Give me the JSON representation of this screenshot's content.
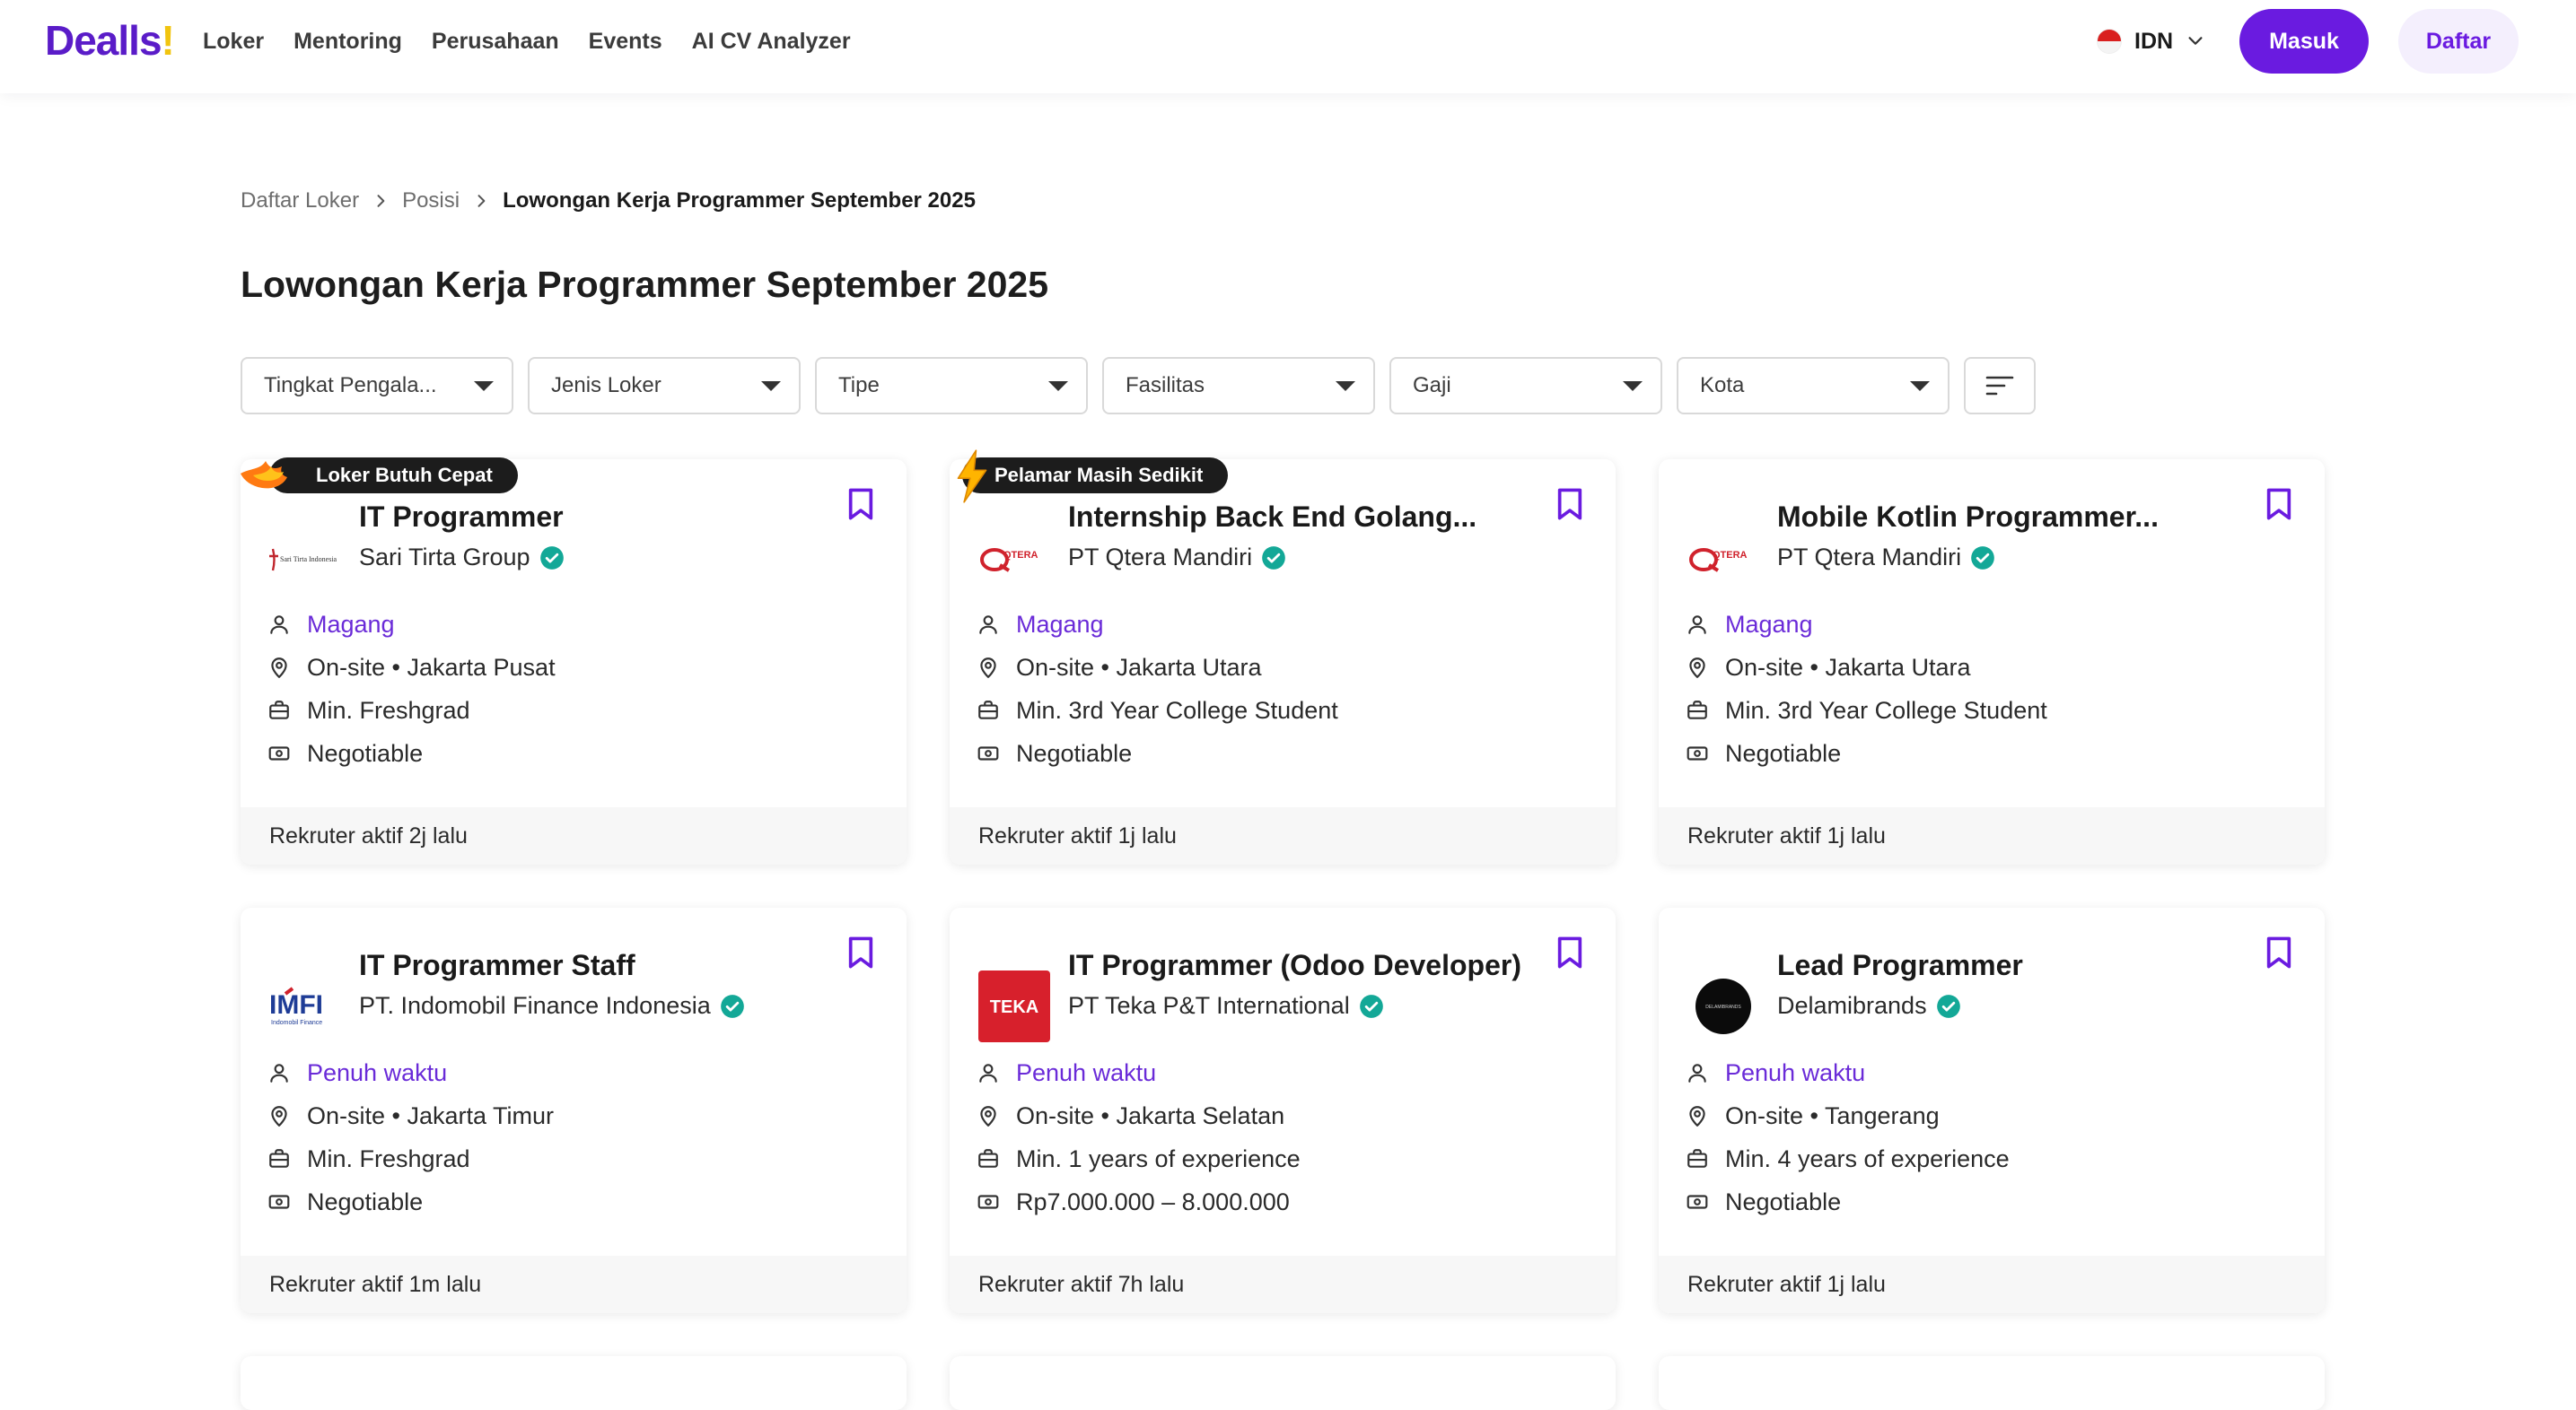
{
  "header": {
    "logo_text": "Dealls",
    "logo_accent": "!",
    "nav": [
      "Loker",
      "Mentoring",
      "Perusahaan",
      "Events",
      "AI CV Analyzer"
    ],
    "lang": "IDN",
    "login": "Masuk",
    "register": "Daftar"
  },
  "breadcrumb": [
    "Daftar Loker",
    "Posisi",
    "Lowongan Kerja Programmer September 2025"
  ],
  "page_title": "Lowongan Kerja Programmer September 2025",
  "filters": [
    "Tingkat Pengala...",
    "Jenis Loker",
    "Tipe",
    "Fasilitas",
    "Gaji",
    "Kota"
  ],
  "colors": {
    "brand": "#6a1be0",
    "accent_text": "#6a2bd8",
    "verified": "#13a897"
  },
  "jobs": [
    {
      "badge": "Loker Butuh Cepat",
      "badge_icon": "fire-icon",
      "title": "IT Programmer",
      "company": "Sari Tirta Group",
      "logo_text": "Sari Tirta Indonesia",
      "type": "Magang",
      "location": "On-site • Jakarta Pusat",
      "experience": "Min. Freshgrad",
      "salary": "Negotiable",
      "footer": "Rekruter aktif 2j lalu"
    },
    {
      "badge": "Pelamar Masih Sedikit",
      "badge_icon": "lightning-icon",
      "title": "Internship Back End Golang...",
      "company": "PT Qtera Mandiri",
      "logo_text": "QTERA",
      "type": "Magang",
      "location": "On-site • Jakarta Utara",
      "experience": "Min. 3rd Year College Student",
      "salary": "Negotiable",
      "footer": "Rekruter aktif 1j lalu"
    },
    {
      "badge": "",
      "badge_icon": "",
      "title": "Mobile Kotlin Programmer...",
      "company": "PT Qtera Mandiri",
      "logo_text": "QTERA",
      "type": "Magang",
      "location": "On-site • Jakarta Utara",
      "experience": "Min. 3rd Year College Student",
      "salary": "Negotiable",
      "footer": "Rekruter aktif 1j lalu"
    },
    {
      "badge": "",
      "badge_icon": "",
      "title": "IT Programmer Staff",
      "company": "PT. Indomobil Finance Indonesia",
      "logo_text": "IMFI",
      "logo_sub": "Indomobil Finance",
      "type": "Penuh waktu",
      "location": "On-site • Jakarta Timur",
      "experience": "Min. Freshgrad",
      "salary": "Negotiable",
      "footer": "Rekruter aktif 1m lalu"
    },
    {
      "badge": "",
      "badge_icon": "",
      "title": "IT Programmer (Odoo Developer)",
      "company": "PT Teka P&T International",
      "logo_text": "TEKA",
      "type": "Penuh waktu",
      "location": "On-site • Jakarta Selatan",
      "experience": "Min. 1 years of experience",
      "salary": "Rp7.000.000 – 8.000.000",
      "footer": "Rekruter aktif 7h lalu"
    },
    {
      "badge": "",
      "badge_icon": "",
      "title": "Lead Programmer",
      "company": "Delamibrands",
      "logo_text": "DELAMIBRANDS",
      "type": "Penuh waktu",
      "location": "On-site • Tangerang",
      "experience": "Min. 4 years of experience",
      "salary": "Negotiable",
      "footer": "Rekruter aktif 1j lalu"
    }
  ]
}
